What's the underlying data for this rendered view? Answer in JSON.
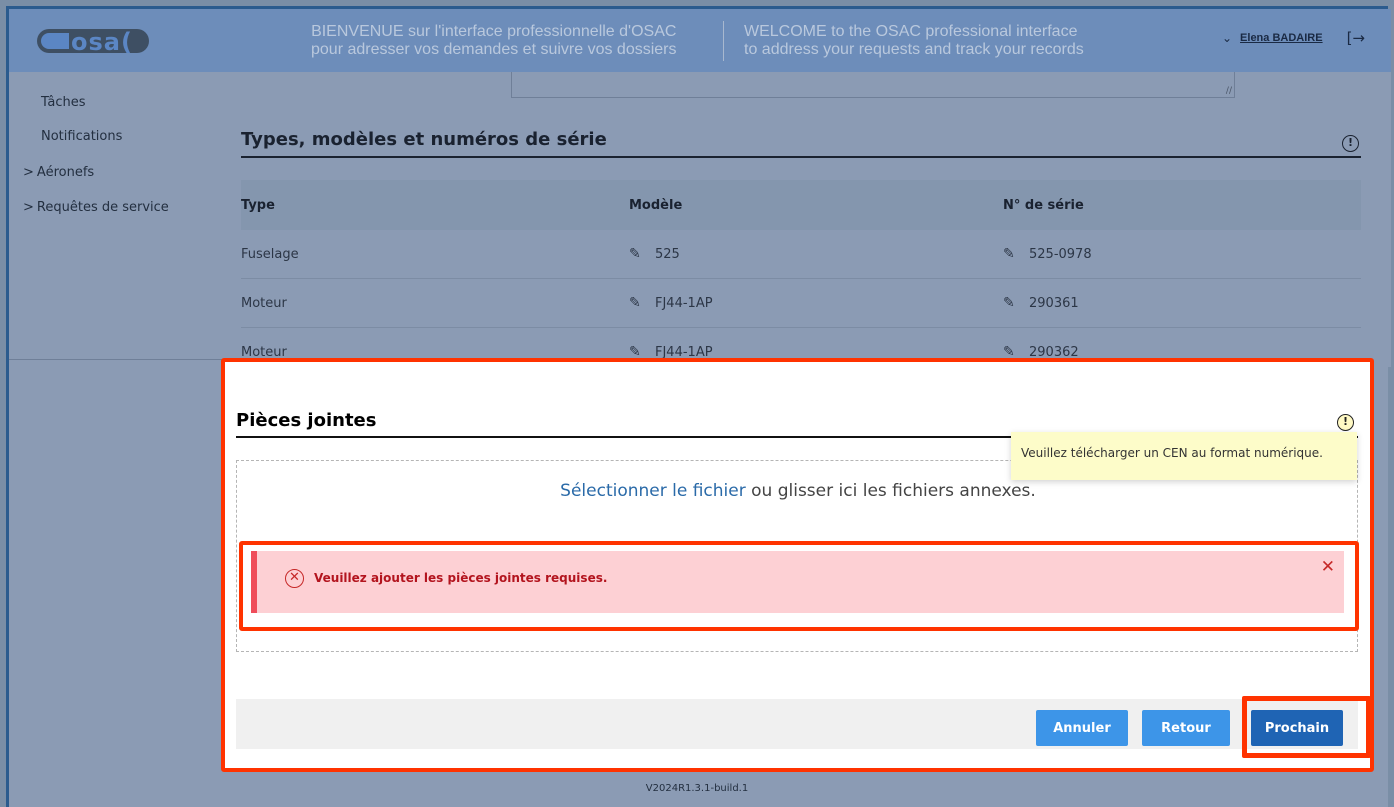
{
  "header": {
    "logo_text": "osa(",
    "welcome_fr_line1": "BIENVENUE sur l'interface professionnelle d'OSAC",
    "welcome_fr_line2": "pour adresser vos demandes et suivre vos dossiers",
    "welcome_en_line1": "WELCOME to the OSAC professional interface",
    "welcome_en_line2": "to address your requests and track your records",
    "user_name": "Elena BADAIRE"
  },
  "sidebar": {
    "items": [
      {
        "label": "Tâches",
        "expandable": false
      },
      {
        "label": "Notifications",
        "expandable": false
      },
      {
        "label": "Aéronefs",
        "expandable": true
      },
      {
        "label": "Requêtes de service",
        "expandable": true
      }
    ]
  },
  "types_section": {
    "title": "Types, modèles et numéros de série",
    "columns": [
      "Type",
      "Modèle",
      "N° de série"
    ],
    "rows": [
      {
        "type": "Fuselage",
        "model": "525",
        "serial": "525-0978"
      },
      {
        "type": "Moteur",
        "model": "FJ44-1AP",
        "serial": "290361"
      },
      {
        "type": "Moteur",
        "model": "FJ44-1AP",
        "serial": "290362"
      }
    ]
  },
  "attachments": {
    "title": "Pièces jointes",
    "tooltip": "Veuillez télécharger un CEN au format numérique.",
    "drop_link": "Sélectionner le fichier",
    "drop_rest": " ou glisser ici les fichiers annexes.",
    "error_message": "Veuillez ajouter les pièces jointes requises."
  },
  "actions": {
    "cancel_label": "Annuler",
    "back_label": "Retour",
    "next_label": "Prochain"
  },
  "footer": {
    "version": "V2024R1.3.1-build.1"
  },
  "icons": {
    "info": "info-circle-icon",
    "pencil": "pencil-icon",
    "error": "error-circle-x-icon",
    "close": "close-x-icon",
    "logout": "logout-arrow-icon",
    "chevron": "chevron-down-icon"
  },
  "colors": {
    "accent": "#3d95e8",
    "primary_dark": "#1f64b4",
    "error_bg": "#fdd0d4",
    "error_text": "#b3141e",
    "highlight_outline": "#ff3300",
    "tooltip_bg": "#fdfcc9",
    "header_bg": "#6d8dba"
  }
}
